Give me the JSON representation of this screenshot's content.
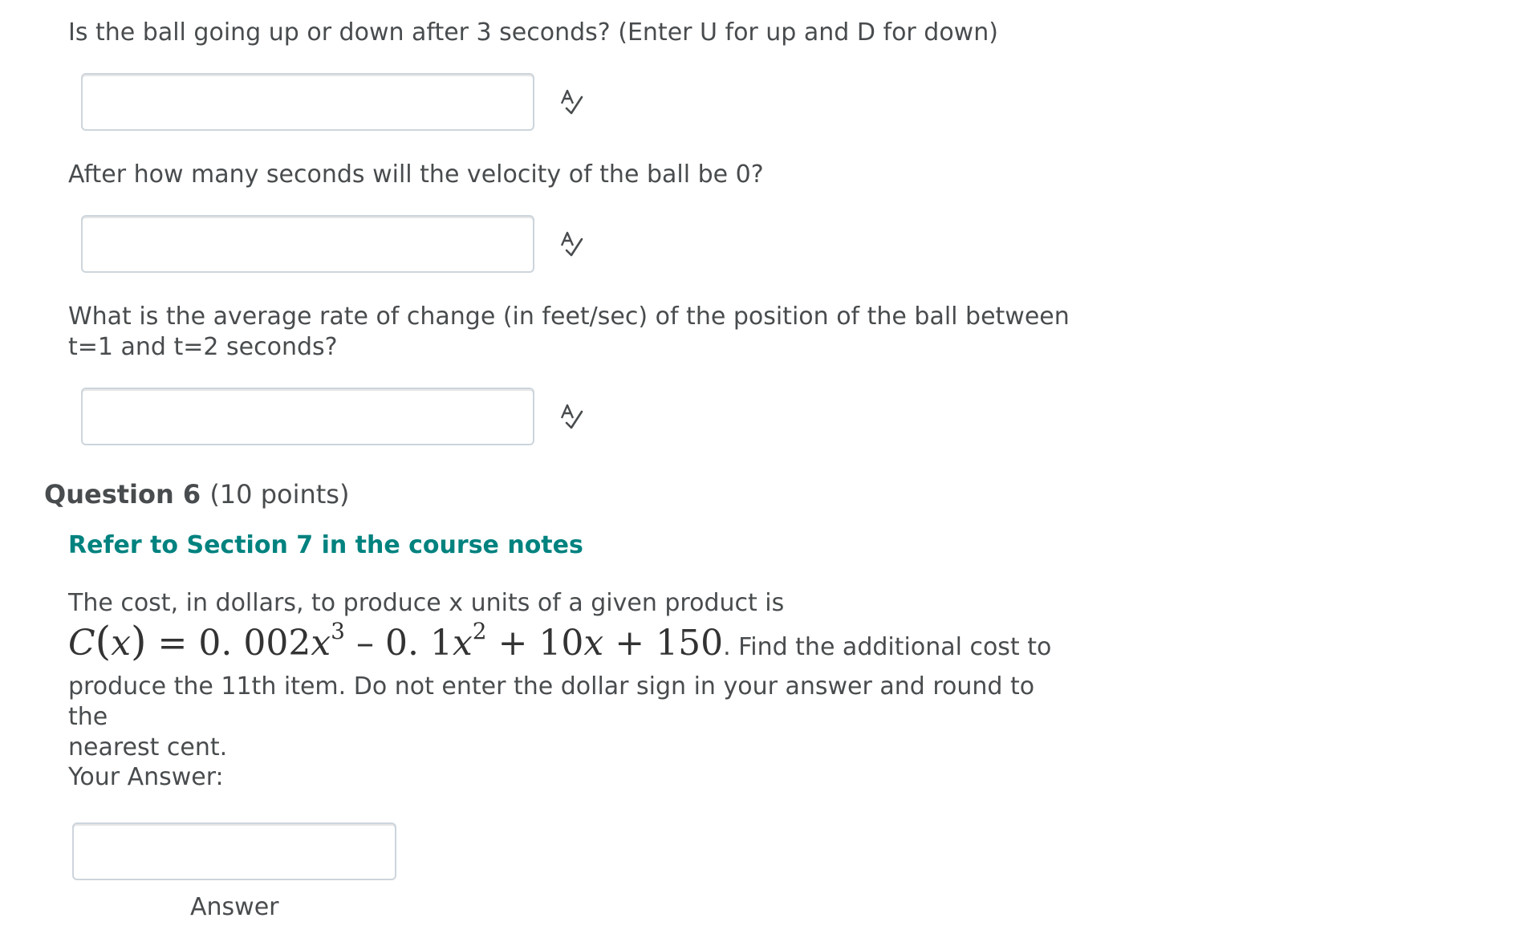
{
  "questions": [
    {
      "prompt": "Is the ball going up or down after 3 seconds? (Enter U for up and D for down)",
      "input_value": "",
      "spellcheck_icon": "spellcheck-icon"
    },
    {
      "prompt": "After how many seconds will the velocity of the ball be 0?",
      "input_value": "",
      "spellcheck_icon": "spellcheck-icon"
    },
    {
      "prompt_line1": "What is the average rate of change (in feet/sec) of the position of the ball between",
      "prompt_line2": "t=1 and t=2 seconds?",
      "input_value": "",
      "spellcheck_icon": "spellcheck-icon"
    }
  ],
  "question6": {
    "title": "Question 6",
    "points": "(10 points)",
    "link_text": "Refer to Section 7 in the course notes",
    "text_line1": "The cost, in dollars, to produce x units of a given product is",
    "formula": {
      "fn": "C",
      "var": "x",
      "equals": "= 0. 002",
      "term1_var": "x",
      "term1_exp": "3",
      "minus": " – 0. 1",
      "term2_var": "x",
      "term2_exp": "2",
      "plus1": " + 10",
      "term3_var": "x",
      "plus2": " + 150",
      "period": "."
    },
    "text_after_formula": " Find the additional cost to",
    "text_line3": "produce the 11th item. Do not enter the dollar sign in your answer and round to the",
    "text_line4": "nearest cent.",
    "your_answer_label": "Your Answer:",
    "answer_value": "",
    "answer_label": "Answer"
  },
  "colors": {
    "link": "#00827f",
    "text": "#494c4e",
    "input_border": "#cdd5dc"
  }
}
